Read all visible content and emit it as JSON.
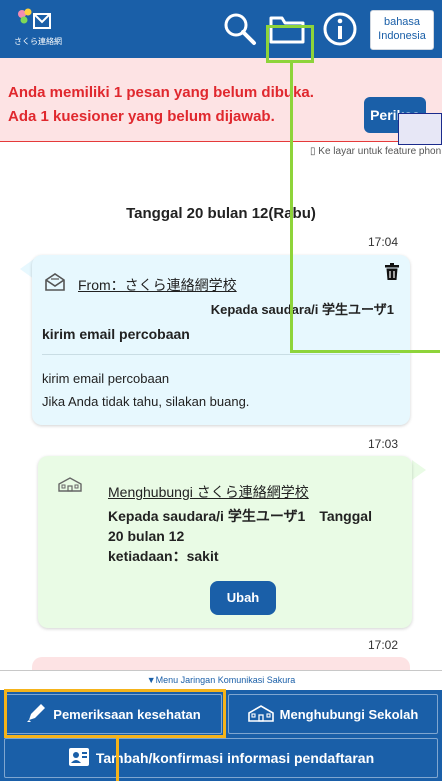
{
  "header": {
    "logo_text": "さくら連絡網",
    "lang_line1": "bahasa",
    "lang_line2": "Indonesia"
  },
  "alert": {
    "line1": "Anda memiliki 1 pesan yang belum dibuka.",
    "line2": "Ada 1 kuesioner yang belum dijawab.",
    "check_button": "Periksa"
  },
  "phone_link": "Ke layar untuk feature phon",
  "date_heading": "Tanggal 20 bulan 12(Rabu)",
  "messages": [
    {
      "time": "17:04",
      "from": "From：さくら連絡網学校",
      "to": "Kepada saudara/i 学生ユーザ1",
      "subject": "kirim email percobaan",
      "body_line1": "kirim email percobaan",
      "body_line2": "Jika Anda tidak tahu, silakan buang."
    },
    {
      "time": "17:03",
      "contact": "Menghubungi さくら連絡網学校",
      "detail_line1": "Kepada saudara/i 学生ユーザ1　Tanggal",
      "detail_line2": "20 bulan 12",
      "detail_line3": "ketiadaan：sakit",
      "edit_button": "Ubah"
    },
    {
      "time": "17:02"
    }
  ],
  "menu_label": "▼Menu Jaringan Komunikasi Sakura",
  "bottom_nav": {
    "health_check": "Pemeriksaan kesehatan",
    "contact_school": "Menghubungi Sekolah",
    "registration": "Tambah/konfirmasi informasi pendaftaran"
  },
  "colors": {
    "primary": "#1a5fa8",
    "alert_bg": "#fde3e4",
    "alert_text": "#e0282e",
    "highlight_green": "#8ed43a",
    "highlight_orange": "#f5b31a"
  },
  "icons": {
    "search": "search-icon",
    "folder": "folder-icon",
    "info": "info-icon",
    "envelope": "envelope-icon",
    "trash": "trash-icon",
    "school": "school-icon",
    "pencil": "pencil-icon",
    "id_card": "id-card-icon"
  }
}
